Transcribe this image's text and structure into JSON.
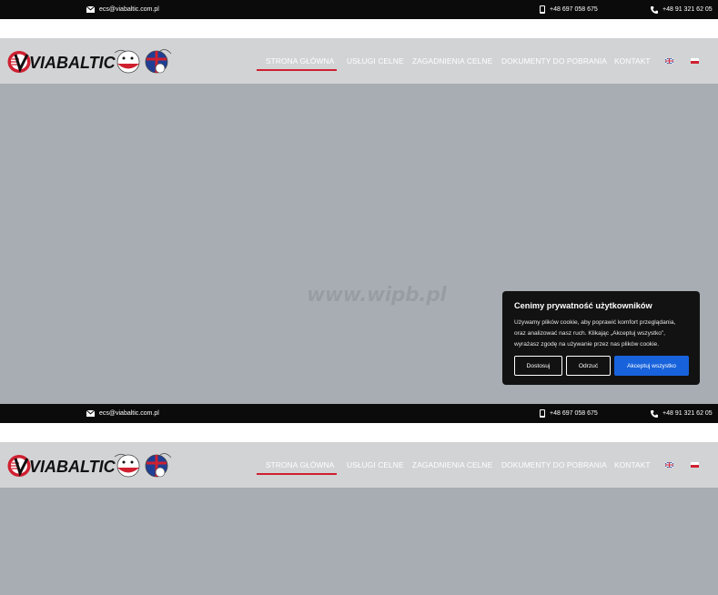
{
  "topbar": {
    "email": "ecs@viabaltic.com.pl",
    "mobile": "+48 697 058 675",
    "phone": "+48 91 321 62 05",
    "icons": [
      "envelope-icon",
      "mobile-phone-icon",
      "phone-icon"
    ]
  },
  "brand": {
    "logo_text": "VIABALTIC"
  },
  "nav": {
    "items": [
      "STRONA GŁÓWNA",
      "USŁUGI CELNE",
      "ZAGADNIENIA CELNE",
      "DOKUMENTY DO POBRANIA",
      "KONTAKT"
    ],
    "active_index": 0,
    "languages": [
      "en-flag",
      "pl-flag"
    ]
  },
  "hero": {
    "watermark": "www.wipb.pl"
  },
  "cookie": {
    "title": "Cenimy prywatność użytkowników",
    "line1": "Używamy plików cookie, aby poprawić komfort przeglądania,",
    "line2": "oraz analizować nasz ruch. Klikając „Akceptuj wszystko”,",
    "line3": "wyrażasz zgodę na używanie przez nas plików cookie.",
    "customize_label": "Dostosuj",
    "reject_label": "Odrzuć",
    "accept_label": "Akceptuj wszystko"
  },
  "colors": {
    "topbar_bg": "#0b0b0b",
    "nav_bg": "#d2d3d5",
    "hero_bg": "#a7adb3",
    "accent_red": "#cf2030",
    "cookie_bg": "#121212",
    "accept_blue": "#1863dc"
  }
}
